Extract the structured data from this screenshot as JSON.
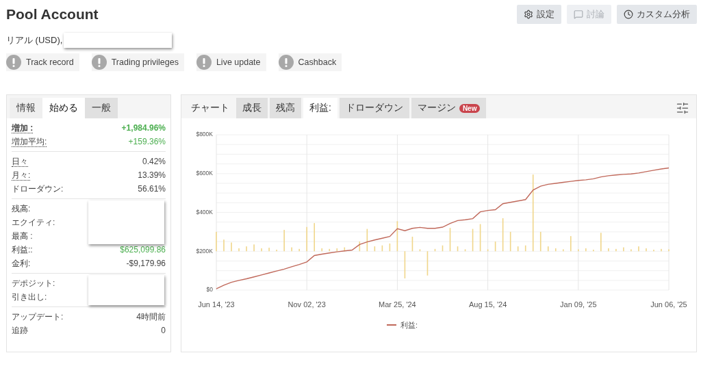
{
  "header": {
    "title": "Pool Account",
    "actions": [
      {
        "kind": "settings",
        "label": "設定",
        "disabled": false
      },
      {
        "kind": "discussion",
        "label": "討論",
        "disabled": true
      },
      {
        "kind": "analysis",
        "label": "カスタム分析",
        "disabled": false
      }
    ]
  },
  "account": {
    "type": "リアル (USD),",
    "redacted": true
  },
  "badges": [
    {
      "label": "Track record"
    },
    {
      "label": "Trading privileges"
    },
    {
      "label": "Live update"
    },
    {
      "label": "Cashback"
    }
  ],
  "stats_panel": {
    "tabs": [
      {
        "label": "情報",
        "selected": false
      },
      {
        "label": "始める",
        "selected": true
      },
      {
        "label": "一般",
        "selected": false
      }
    ],
    "groups": [
      {
        "rows": [
          {
            "label": "増加 :",
            "value": "+1,984.96%",
            "positive": true,
            "underlined": true,
            "bold": true
          },
          {
            "label": "増加平均:",
            "value": "+159.36%",
            "positive": true,
            "underlined": true,
            "bold": false
          }
        ]
      },
      {
        "rows": [
          {
            "label": "日々",
            "value": "0.42%",
            "positive": false,
            "underlined": true,
            "bold": false
          },
          {
            "label": "月々:",
            "value": "13.39%",
            "positive": false,
            "underlined": true,
            "bold": false
          },
          {
            "label": "ドローダウン:",
            "value": "56.61%",
            "positive": false,
            "underlined": false,
            "bold": false
          }
        ]
      },
      {
        "rows": [
          {
            "label": "残高:",
            "hidden": true
          },
          {
            "label": "エクイティ:",
            "hidden": true
          },
          {
            "label": "最高 :",
            "hidden": true
          },
          {
            "label": "利益::",
            "value": "$625,099.86",
            "positive": true,
            "underlined": false,
            "bold": false
          },
          {
            "label": "金利:",
            "value": "-$9,179.96",
            "positive": false,
            "underlined": false,
            "bold": false
          }
        ]
      },
      {
        "rows": [
          {
            "label": "デポジット:",
            "hidden": true
          },
          {
            "label": "引き出し:",
            "hidden": true
          }
        ]
      },
      {
        "rows": [
          {
            "label": "アップデート:",
            "value": "4時間前",
            "positive": false,
            "underlined": false,
            "bold": false
          },
          {
            "label": "追跡",
            "value": "0",
            "positive": false,
            "underlined": false,
            "bold": false
          }
        ]
      }
    ]
  },
  "chart_panel": {
    "title": "チャート",
    "tabs": [
      {
        "label": "成長",
        "selected": false
      },
      {
        "label": "残高",
        "selected": false
      },
      {
        "label": "利益:",
        "selected": true
      },
      {
        "label": "ドローダウン",
        "selected": false
      },
      {
        "label": "マージン",
        "selected": false,
        "badge": "New"
      }
    ],
    "chart_data": {
      "type": "line",
      "grid": true,
      "categories": [
        "Jun 14, '23",
        null,
        null,
        null,
        null,
        null,
        null,
        null,
        null,
        null,
        null,
        null,
        "Nov 02, '23",
        null,
        null,
        null,
        null,
        null,
        null,
        null,
        null,
        null,
        null,
        null,
        "Mar 25, '24",
        null,
        null,
        null,
        null,
        null,
        null,
        null,
        null,
        null,
        null,
        null,
        "Aug 15, '24",
        null,
        null,
        null,
        null,
        null,
        null,
        null,
        null,
        null,
        null,
        null,
        "Jan 09, '25",
        null,
        null,
        null,
        null,
        null,
        null,
        null,
        null,
        null,
        null,
        null,
        "Jun 06, '25"
      ],
      "ylim": [
        0,
        800000
      ],
      "yticks": [
        {
          "value": 0,
          "label": "$0"
        },
        {
          "value": 200000,
          "label": "$200K"
        },
        {
          "value": 400000,
          "label": "$400K"
        },
        {
          "value": 600000,
          "label": "$600K"
        },
        {
          "value": 800000,
          "label": "$800K"
        }
      ],
      "series": [
        {
          "name": "利益:",
          "color": "#c0685a",
          "values": [
            7000,
            25000,
            40000,
            50000,
            58000,
            68000,
            78000,
            88000,
            98000,
            108000,
            120000,
            132000,
            145000,
            178000,
            185000,
            191000,
            197000,
            202000,
            206000,
            235000,
            248000,
            258000,
            267000,
            276000,
            316000,
            306000,
            318000,
            323000,
            318000,
            318000,
            324000,
            343000,
            358000,
            362000,
            368000,
            403000,
            410000,
            414000,
            445000,
            452000,
            459000,
            466000,
            515000,
            535000,
            545000,
            550000,
            555000,
            560000,
            565000,
            568000,
            573000,
            583000,
            589000,
            593000,
            596000,
            598000,
            603000,
            610000,
            617000,
            624000,
            629000
          ]
        },
        {
          "type": "bar",
          "color": "#f0d68a",
          "base": [
            200000,
            200000,
            200000,
            200000,
            200000,
            200000,
            200000,
            200000,
            200000,
            200000,
            200000,
            200000,
            200000,
            200000,
            200000,
            200000,
            200000,
            200000,
            null,
            200000,
            200000,
            200000,
            200000,
            200000,
            200000,
            200000,
            200000,
            200000,
            200000,
            200000,
            200000,
            200000,
            200000,
            200000,
            200000,
            200000,
            200000,
            200000,
            200000,
            200000,
            200000,
            200000,
            200000,
            200000,
            200000,
            200000,
            200000,
            200000,
            200000,
            200000,
            200000,
            200000,
            200000,
            200000,
            200000,
            200000,
            200000,
            200000,
            200000,
            200000,
            200000
          ],
          "values": [
            100000,
            60000,
            45000,
            15000,
            25000,
            35000,
            15000,
            18000,
            8000,
            110000,
            20000,
            12000,
            125000,
            145000,
            15000,
            12000,
            15000,
            20000,
            null,
            50000,
            115000,
            25000,
            30000,
            40000,
            155000,
            -140000,
            75000,
            10000,
            -125000,
            12000,
            30000,
            120000,
            25000,
            10000,
            115000,
            140000,
            10000,
            50000,
            170000,
            100000,
            25000,
            30000,
            395000,
            100000,
            25000,
            15000,
            10000,
            78000,
            10000,
            15000,
            8000,
            95000,
            15000,
            12000,
            20000,
            10000,
            25000,
            15000,
            8000,
            12000,
            10000
          ]
        }
      ]
    }
  }
}
